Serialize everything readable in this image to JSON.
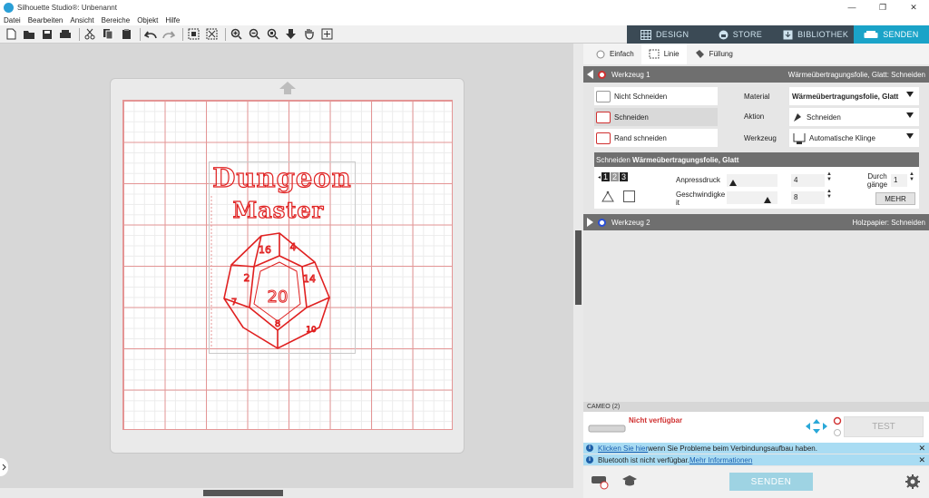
{
  "window": {
    "title": "Silhouette Studio®: Unbenannt",
    "controls": [
      "—",
      "❐",
      "✕"
    ]
  },
  "menu": [
    "Datei",
    "Bearbeiten",
    "Ansicht",
    "Bereiche",
    "Objekt",
    "Hilfe"
  ],
  "top_tabs": [
    {
      "label": "DESIGN",
      "icon": "grid-icon"
    },
    {
      "label": "STORE",
      "icon": "store-icon"
    },
    {
      "label": "BIBLIOTHEK",
      "icon": "library-icon"
    },
    {
      "label": "SENDEN",
      "icon": "send-icon",
      "active": true
    }
  ],
  "design": {
    "line1": "Dungeon",
    "line2": "Master",
    "die_center": "20",
    "die_numbers": [
      "16",
      "4",
      "2",
      "14",
      "7",
      "8",
      "10"
    ]
  },
  "panel": {
    "subtabs": [
      {
        "label": "Einfach"
      },
      {
        "label": "Linie",
        "active": true
      },
      {
        "label": "Füllung"
      }
    ],
    "tool1": {
      "label": "Werkzeug 1",
      "summary": "Wärmeübertragungsfolie, Glatt: Schneiden",
      "color": "#d03030"
    },
    "options": [
      "Nicht Schneiden",
      "Schneiden",
      "Rand schneiden"
    ],
    "selected_option": "Schneiden",
    "material_label": "Material",
    "material_value": "Wärmeübertragungsfolie, Glatt",
    "aktion_label": "Aktion",
    "aktion_value": "Schneiden",
    "werkzeug_label": "Werkzeug",
    "werkzeug_value": "Automatische Klinge",
    "cut_header_prefix": "Schneiden",
    "cut_header_material": "Wärmeübertragungsfolie, Glatt",
    "blade_digits": [
      "1",
      "2",
      "3"
    ],
    "anpressdruck_label": "Anpressdruck",
    "anpressdruck_value": "4",
    "geschwindigkeit_label": "Geschwindigke it",
    "geschwindigkeit_value": "8",
    "durchgaenge_label": "Durch gänge",
    "durchgaenge_value": "1",
    "mehr_label": "MEHR",
    "tool2": {
      "label": "Werkzeug 2",
      "summary": "Holzpapier: Schneiden",
      "color": "#2a4fd6"
    },
    "device": "CAMEO (2)",
    "device_status": "Nicht verfügbar",
    "test_label": "TEST",
    "notice1": {
      "link": "Klicken Sie hier",
      "text": " wenn Sie Probleme beim Verbindungsaufbau haben."
    },
    "notice2": {
      "text": "Bluetooth ist nicht verfügbar. ",
      "link": "Mehr Informationen"
    },
    "send_label": "SENDEN"
  }
}
